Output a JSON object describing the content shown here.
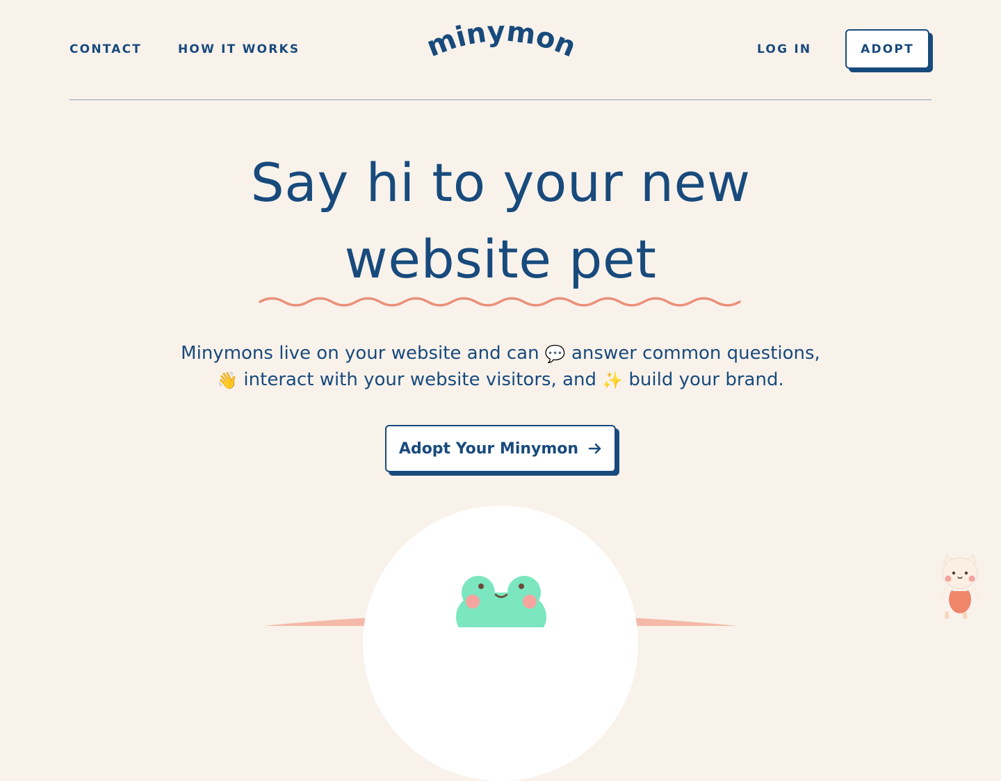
{
  "nav": {
    "contact": "CONTACT",
    "how_it_works": "HOW IT WORKS",
    "logo": "minymon",
    "log_in": "LOG IN",
    "adopt": "ADOPT"
  },
  "hero": {
    "headline_line1": "Say hi to your new",
    "headline_line2": "website pet",
    "subtitle_a": "Minymons live on your website and can",
    "emoji_speech": "💬",
    "subtitle_b": "answer common questions,",
    "emoji_wave": "👋",
    "subtitle_c": "interact with your website visitors, and",
    "emoji_sparkles": "✨",
    "subtitle_d": "build your brand.",
    "cta_label": "Adopt Your Minymon"
  },
  "icons": {
    "cta_arrow": "arrow-right-icon",
    "squiggle": "wavy-underline",
    "frog": "frog-mascot",
    "cat": "cat-mascot"
  },
  "colors": {
    "background": "#f8f2eb",
    "primary": "#184a7c",
    "accent": "#ea8f78",
    "frog_green": "#7be6c0",
    "blush": "#f6a4a0",
    "white": "#ffffff"
  }
}
